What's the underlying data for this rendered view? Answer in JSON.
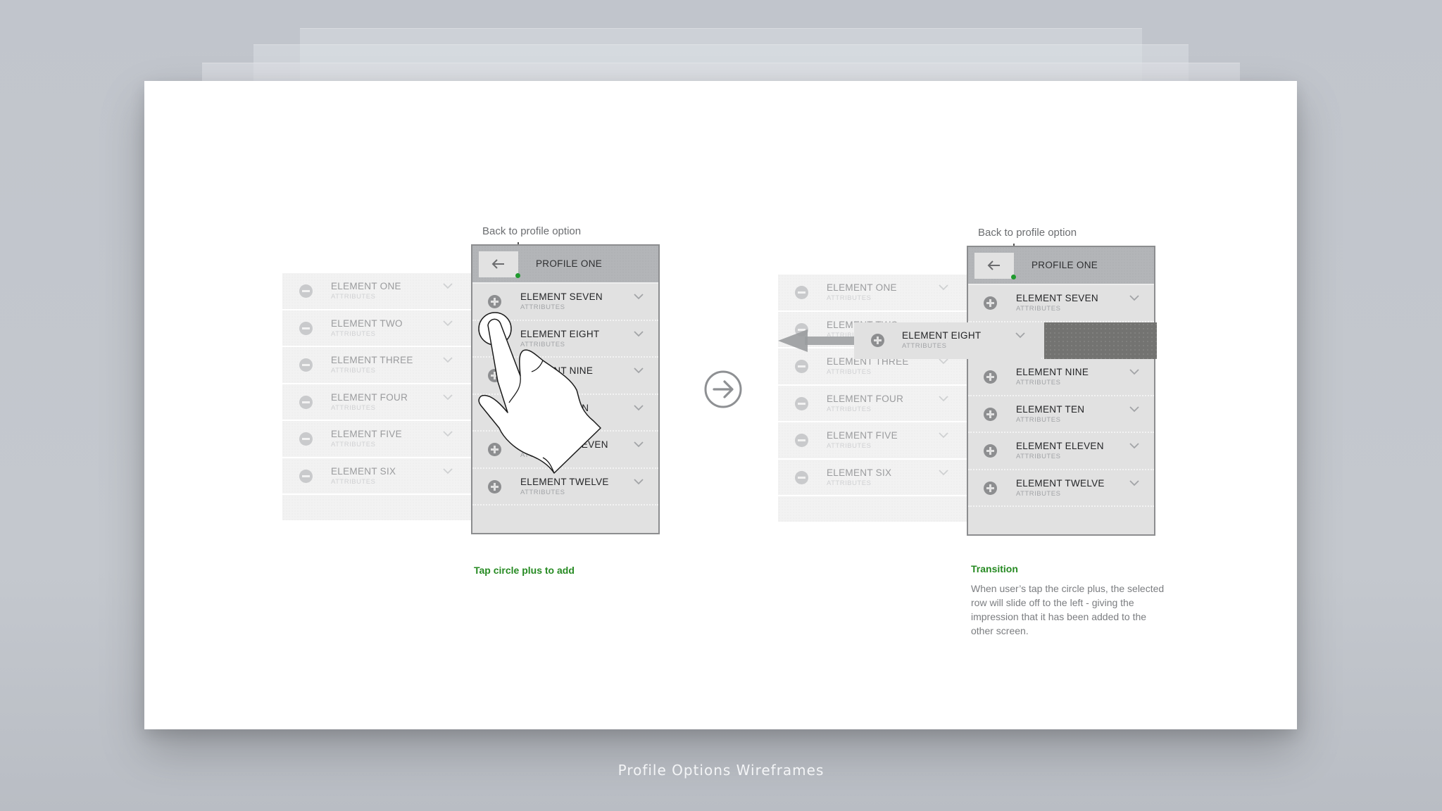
{
  "caption": "Profile Options Wireframes",
  "colors": {
    "annotation_green": "#268a22",
    "dot_green": "#1f9a2e",
    "header_gray": "#b3b5b8",
    "row_gray": "#e1e1e1",
    "background": "#c1c5cc"
  },
  "left_panel": {
    "annotation": "Back to profile option",
    "header_title": "PROFILE ONE",
    "back_icon": "arrow-left-icon",
    "background_list": [
      {
        "name": "ELEMENT ONE",
        "attr": "ATTRIBUTES"
      },
      {
        "name": "ELEMENT TWO",
        "attr": "ATTRIBUTES"
      },
      {
        "name": "ELEMENT THREE",
        "attr": "ATTRIBUTES"
      },
      {
        "name": "ELEMENT FOUR",
        "attr": "ATTRIBUTES"
      },
      {
        "name": "ELEMENT FIVE",
        "attr": "ATTRIBUTES"
      },
      {
        "name": "ELEMENT SIX",
        "attr": "ATTRIBUTES"
      }
    ],
    "phone_list": [
      {
        "name": "ELEMENT SEVEN",
        "attr": "ATTRIBUTES"
      },
      {
        "name": "ELEMENT EIGHT",
        "attr": "ATTRIBUTES"
      },
      {
        "name": "ELEMENT NINE",
        "attr": "ATTRIBUTES"
      },
      {
        "name": "ELEMENT TEN",
        "attr": "ATTRIBUTES"
      },
      {
        "name": "ELEMENT ELEVEN",
        "attr": "ATTRIBUTES"
      },
      {
        "name": "ELEMENT TWELVE",
        "attr": "ATTRIBUTES"
      }
    ],
    "note_title": "Tap circle plus to add"
  },
  "transition_icon": "arrow-right-circle-icon",
  "right_panel": {
    "annotation": "Back to profile option",
    "header_title": "PROFILE ONE",
    "back_icon": "arrow-left-icon",
    "background_list": [
      {
        "name": "ELEMENT ONE",
        "attr": "ATTRIBUTES"
      },
      {
        "name": "ELEMENT TWO",
        "attr": "ATTRIBUTES"
      },
      {
        "name": "ELEMENT THREE",
        "attr": "ATTRIBUTES"
      },
      {
        "name": "ELEMENT FOUR",
        "attr": "ATTRIBUTES"
      },
      {
        "name": "ELEMENT FIVE",
        "attr": "ATTRIBUTES"
      },
      {
        "name": "ELEMENT SIX",
        "attr": "ATTRIBUTES"
      }
    ],
    "phone_list": [
      {
        "name": "ELEMENT SEVEN",
        "attr": "ATTRIBUTES"
      },
      {
        "name": "",
        "attr": ""
      },
      {
        "name": "ELEMENT NINE",
        "attr": "ATTRIBUTES"
      },
      {
        "name": "ELEMENT TEN",
        "attr": "ATTRIBUTES"
      },
      {
        "name": "ELEMENT ELEVEN",
        "attr": "ATTRIBUTES"
      },
      {
        "name": "ELEMENT TWELVE",
        "attr": "ATTRIBUTES"
      }
    ],
    "sliding_row": {
      "name": "ELEMENT EIGHT",
      "attr": "ATTRIBUTES"
    },
    "note_title": "Transition",
    "note_body": "When user’s tap the circle plus, the selected row will slide off to the left - giving the impression that it has been added to the other screen."
  }
}
